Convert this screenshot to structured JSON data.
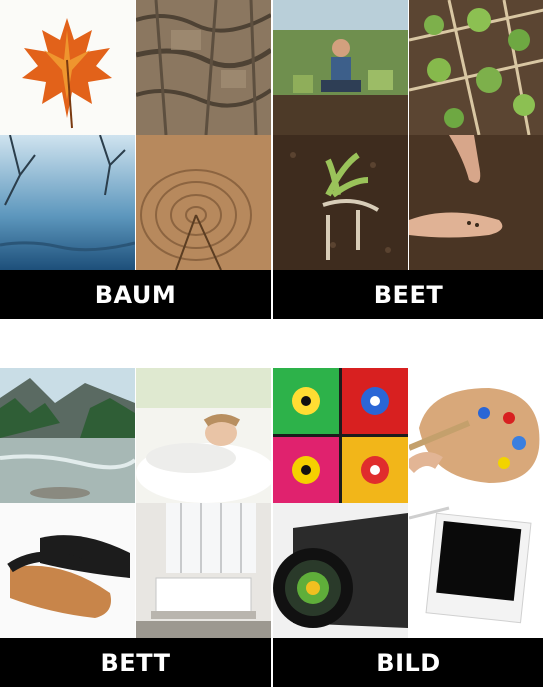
{
  "cards": [
    {
      "word": "BAUM",
      "images": [
        "maple-leaf-icon",
        "tree-bark-icon",
        "misty-lake-icon",
        "tree-rings-icon"
      ]
    },
    {
      "word": "BEET",
      "images": [
        "gardener-icon",
        "garden-bed-icon",
        "soil-cultivator-icon",
        "hand-seeds-icon"
      ]
    },
    {
      "word": "BETT",
      "images": [
        "river-landscape-icon",
        "sleeping-woman-icon",
        "shoes-icon",
        "bedroom-icon"
      ]
    },
    {
      "word": "BILD",
      "images": [
        "abstract-art-icon",
        "paint-palette-icon",
        "camera-lens-icon",
        "photo-frame-icon"
      ]
    }
  ],
  "colors": {
    "label_bg": "#000000",
    "label_text": "#ffffff",
    "page_bg": "#ffffff"
  }
}
